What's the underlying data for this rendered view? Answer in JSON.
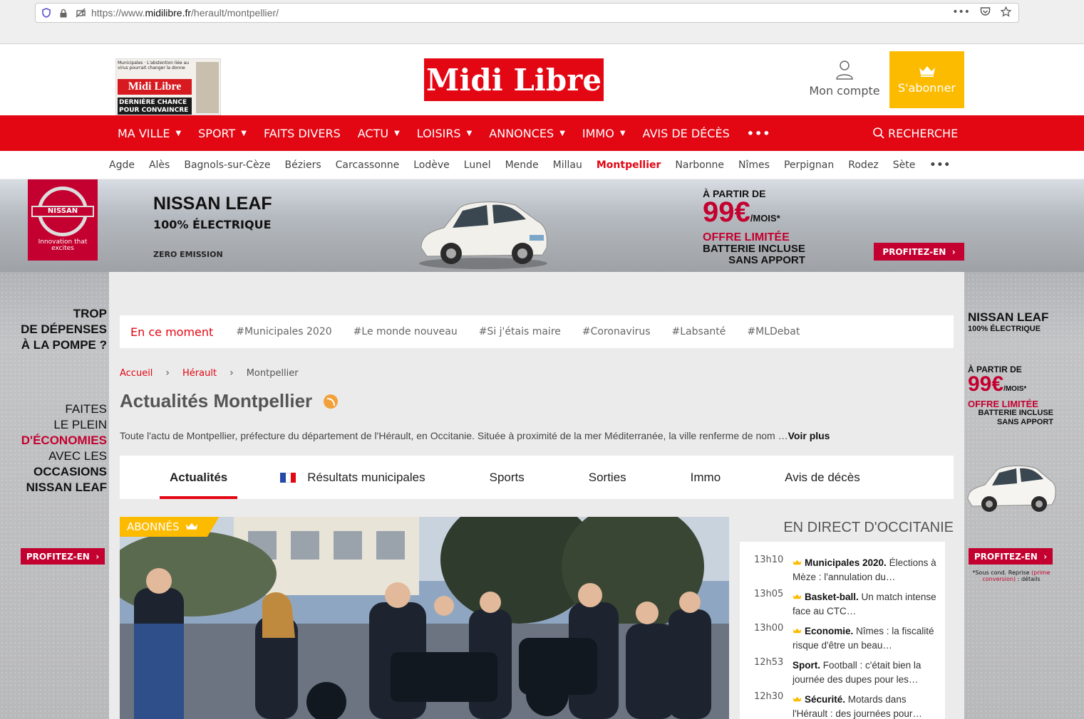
{
  "browser": {
    "url_prefix": "https://www.",
    "url_domain": "midilibre.fr",
    "url_path": "/herault/montpellier/",
    "menu_icon": "•••"
  },
  "header": {
    "logo": "Midi Libre",
    "paper_thumb": {
      "mast": "Midi Libre",
      "headline": "DERNIÈRE CHANCE POUR CONVAINCRE",
      "top_text": "Municipales · L'abstention liée au virus pourrait changer la donne"
    },
    "account_label": "Mon compte",
    "subscribe_label": "S'abonner"
  },
  "mainnav": {
    "items": [
      {
        "label": "MA VILLE",
        "caret": true
      },
      {
        "label": "SPORT",
        "caret": true
      },
      {
        "label": "FAITS DIVERS",
        "caret": false
      },
      {
        "label": "ACTU",
        "caret": true
      },
      {
        "label": "LOISIRS",
        "caret": true
      },
      {
        "label": "ANNONCES",
        "caret": true
      },
      {
        "label": "IMMO",
        "caret": true
      },
      {
        "label": "AVIS DE DÉCÈS",
        "caret": false
      }
    ],
    "more": "•••",
    "search_label": "RECHERCHE"
  },
  "citynav": {
    "items": [
      "Agde",
      "Alès",
      "Bagnols-sur-Cèze",
      "Béziers",
      "Carcassonne",
      "Lodève",
      "Lunel",
      "Mende",
      "Millau",
      "Montpellier",
      "Narbonne",
      "Nîmes",
      "Perpignan",
      "Rodez",
      "Sète"
    ],
    "active": "Montpellier",
    "more": "•••"
  },
  "ad": {
    "brand": "NISSAN",
    "tagline": "Innovation that excites",
    "title": "NISSAN LEAF",
    "subtitle": "100% ÉLECTRIQUE",
    "zero": "ZERO EMISSION",
    "from": "À PARTIR DE",
    "amount": "99€",
    "per_month": "/MOIS*",
    "offer": "OFFRE LIMITÉE",
    "battery": "BATTERIE INCLUSE",
    "no_deposit": "SANS APPORT",
    "cta": "PROFITEZ-EN",
    "left_question": [
      "TROP",
      "DE DÉPENSES",
      "À LA POMPE ?"
    ],
    "left_pitch_1": "FAITES",
    "left_pitch_2": "LE PLEIN",
    "left_pitch_3": "D'ÉCONOMIES",
    "left_pitch_4": "AVEC LES",
    "left_pitch_5": "OCCASIONS",
    "left_pitch_6": "NISSAN LEAF",
    "legal_pre": "*Sous cond. Reprise ",
    "legal_red": "(prime conversion)",
    "legal_post": " : détails"
  },
  "trending": {
    "now_label": "En ce moment",
    "tags": [
      "#Municipales 2020",
      "#Le monde nouveau",
      "#Si j'étais maire",
      "#Coronavirus",
      "#Labsanté",
      "#MLDebat"
    ]
  },
  "breadcrumb": {
    "home": "Accueil",
    "region": "Hérault",
    "current": "Montpellier"
  },
  "page": {
    "title": "Actualités Montpellier",
    "description": "Toute l'actu de Montpellier, préfecture du département de l'Hérault, en Occitanie. Située à proximité de la mer Méditerranée, la ville renferme de nom …",
    "more": "Voir plus"
  },
  "tabs": [
    "Actualités",
    "Résultats municipales",
    "Sports",
    "Sorties",
    "Immo",
    "Avis de décès"
  ],
  "hero": {
    "badge": "ABONNÉS"
  },
  "live": {
    "title": "EN DIRECT D'OCCITANIE",
    "items": [
      {
        "time": "13h10",
        "crown": true,
        "cat": "Municipales 2020.",
        "text": " Élections à Mèze : l'annulation du…"
      },
      {
        "time": "13h05",
        "crown": true,
        "cat": "Basket-ball.",
        "text": " Un match intense face au CTC…"
      },
      {
        "time": "13h00",
        "crown": true,
        "cat": "Economie.",
        "text": " Nîmes : la fiscalité risque d'être un beau…"
      },
      {
        "time": "12h53",
        "crown": false,
        "cat": "Sport.",
        "text": " Football : c'était bien la journée des dupes pour les…"
      },
      {
        "time": "12h30",
        "crown": true,
        "cat": "Sécurité.",
        "text": " Motards dans l'Hérault : des journées pour…"
      }
    ]
  },
  "colors": {
    "brand_red": "#e30613",
    "gold": "#fdbb00",
    "nissan_red": "#c3002f"
  }
}
